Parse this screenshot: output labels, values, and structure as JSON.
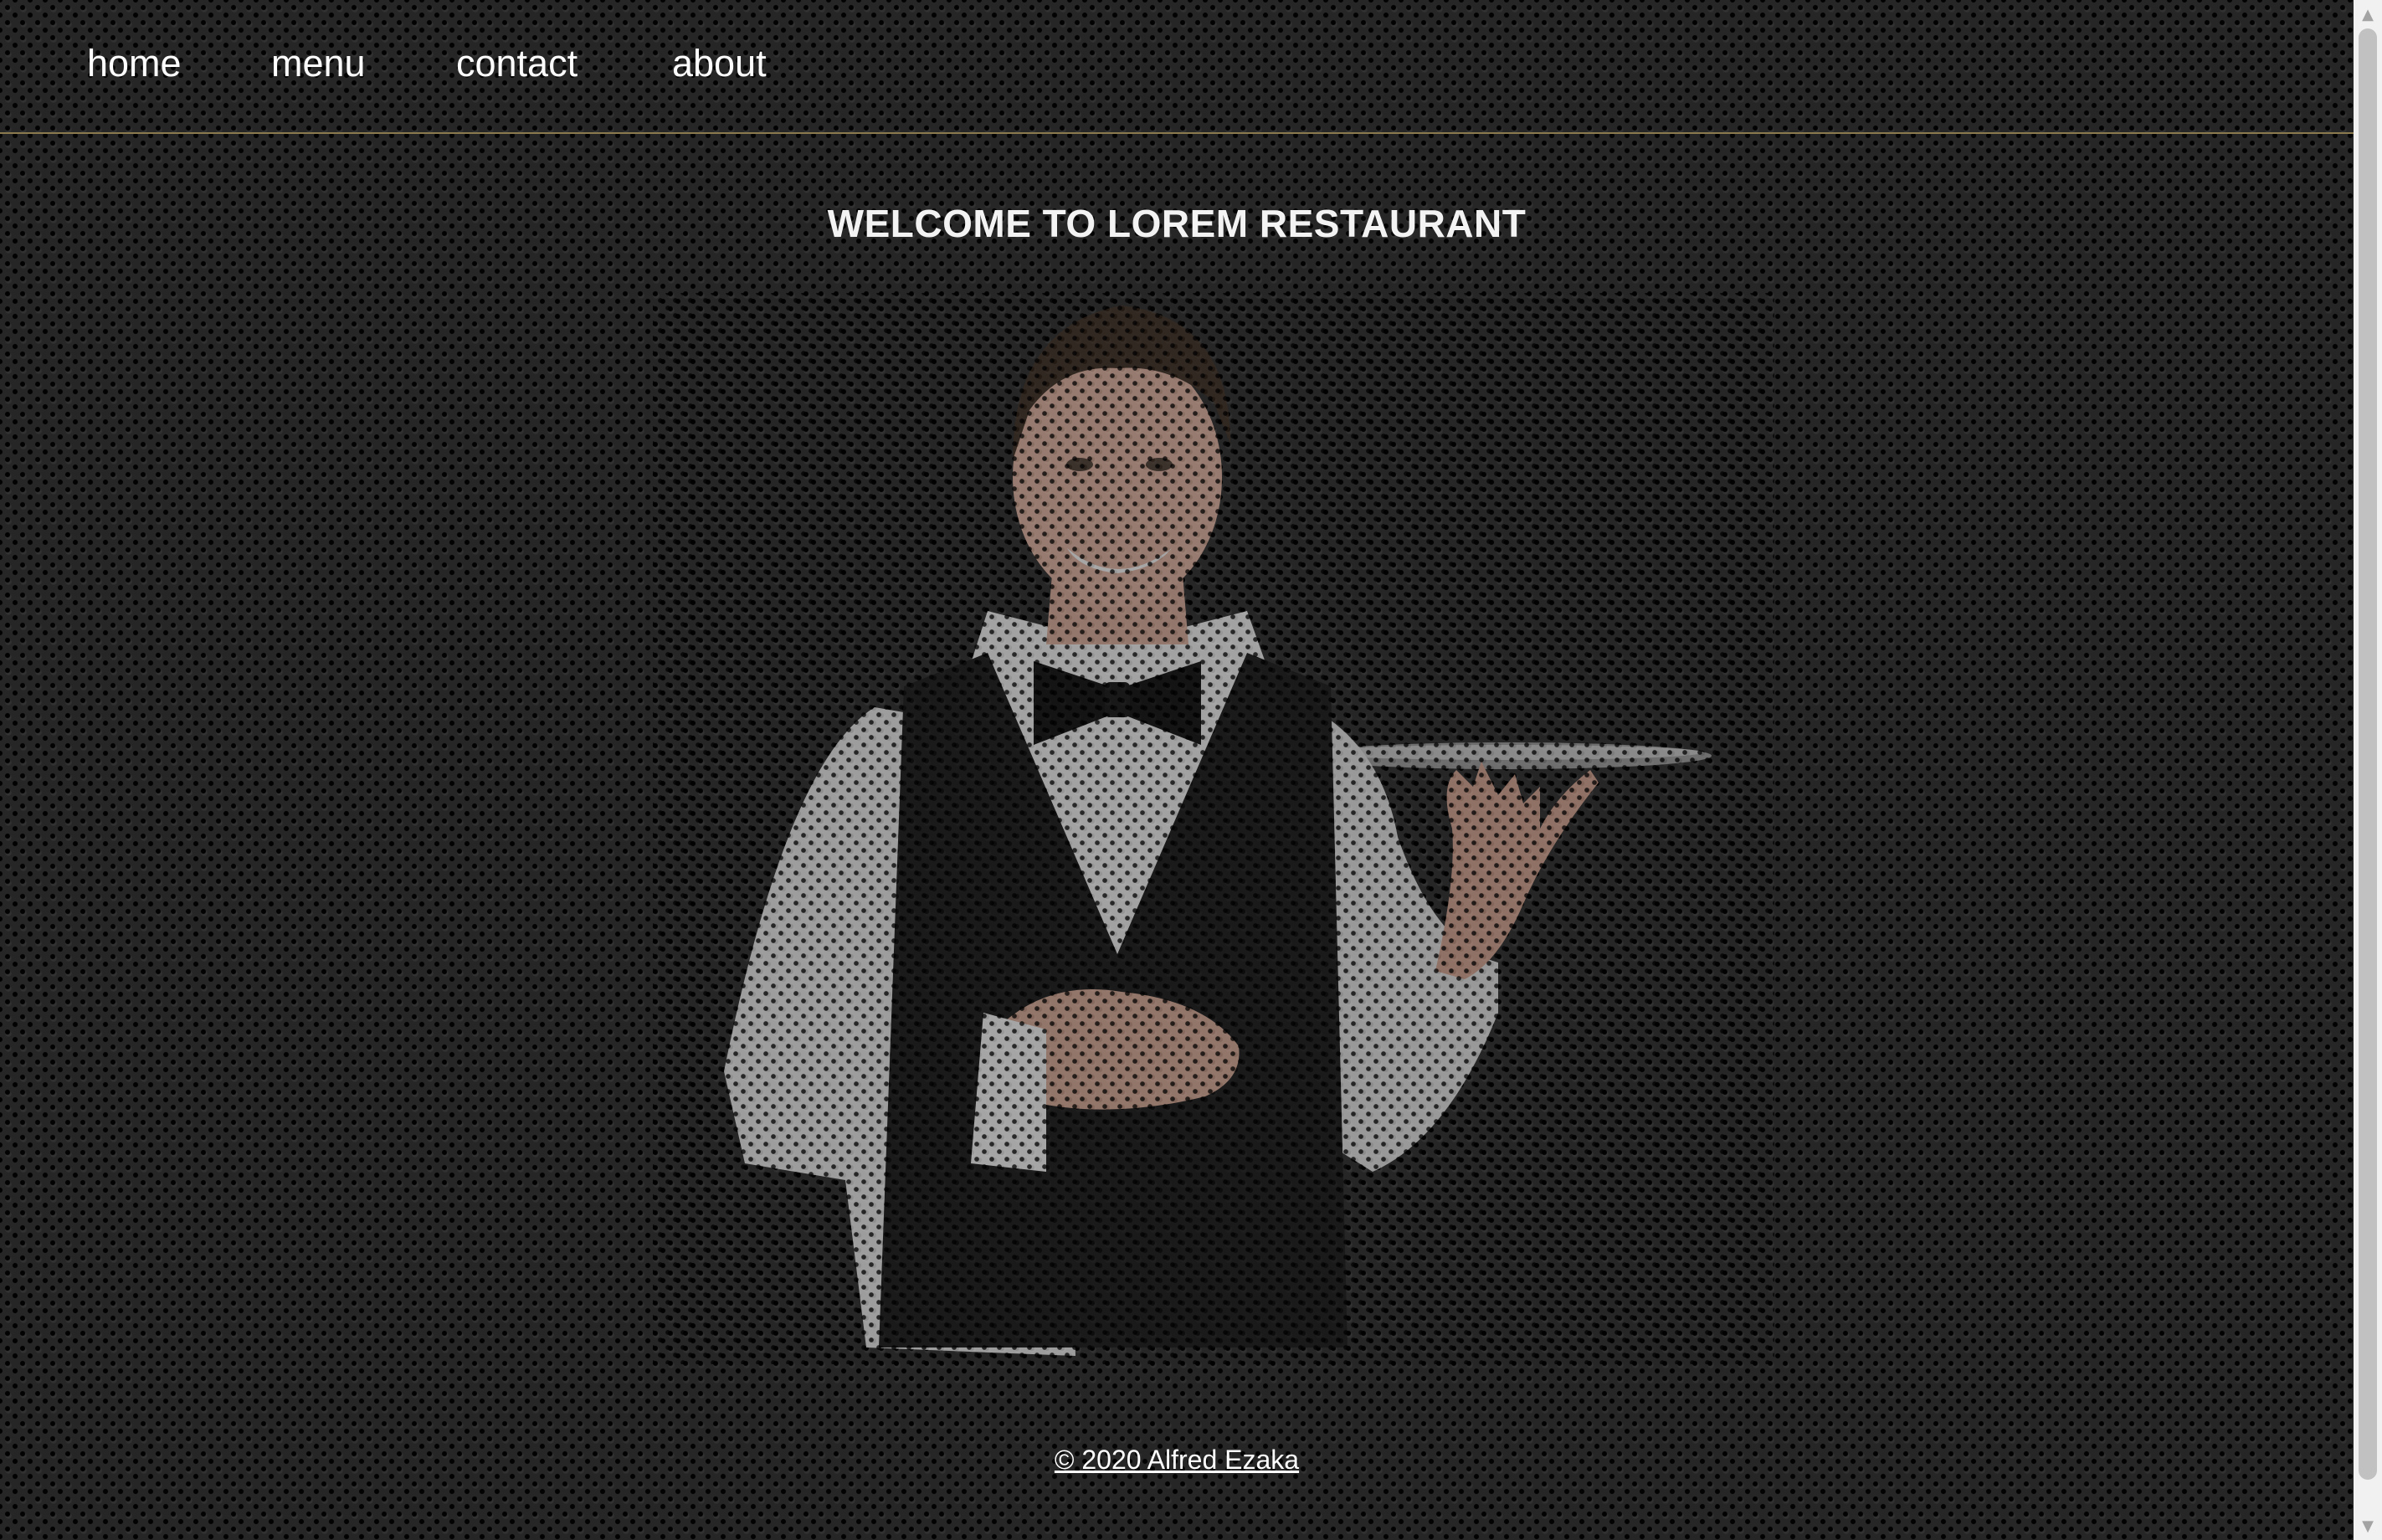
{
  "nav": {
    "items": [
      {
        "label": "home"
      },
      {
        "label": "menu"
      },
      {
        "label": "contact"
      },
      {
        "label": "about"
      }
    ]
  },
  "hero": {
    "title": "WELCOME TO LOREM RESTAURANT",
    "image": "waiter-holding-tray"
  },
  "footer": {
    "text": "© 2020 Alfred Ezaka"
  },
  "colors": {
    "background": "#262626",
    "nav_border": "#8a7a4e",
    "text": "#ffffff"
  },
  "scrollbar": {
    "up_icon": "triangle-up-icon",
    "down_icon": "triangle-down-icon"
  }
}
